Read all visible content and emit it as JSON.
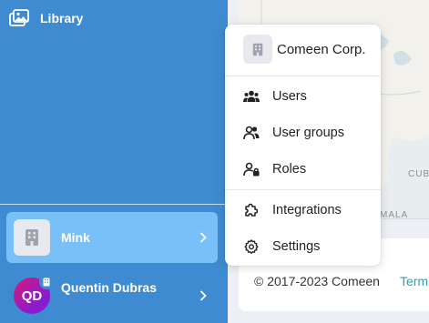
{
  "sidebar": {
    "library_label": "Library",
    "org_name": "Mink",
    "user_name": "Quentin Dubras",
    "user_initials": "QD"
  },
  "menu": {
    "org_name": "Comeen Corp.",
    "items": [
      {
        "label": "Users",
        "icon": "users-icon"
      },
      {
        "label": "User groups",
        "icon": "user-groups-icon"
      },
      {
        "label": "Roles",
        "icon": "roles-icon"
      },
      {
        "label": "Integrations",
        "icon": "puzzle-icon"
      },
      {
        "label": "Settings",
        "icon": "gear-icon"
      }
    ]
  },
  "map": {
    "labels": [
      "CUB",
      "MALA"
    ]
  },
  "footer": {
    "copyright": "© 2017-2023 Comeen",
    "terms_label": "Term"
  },
  "colors": {
    "sidebar_bg": "#3e8bd2",
    "active_org_bg": "#79bff8",
    "link": "#2a9fc2"
  }
}
